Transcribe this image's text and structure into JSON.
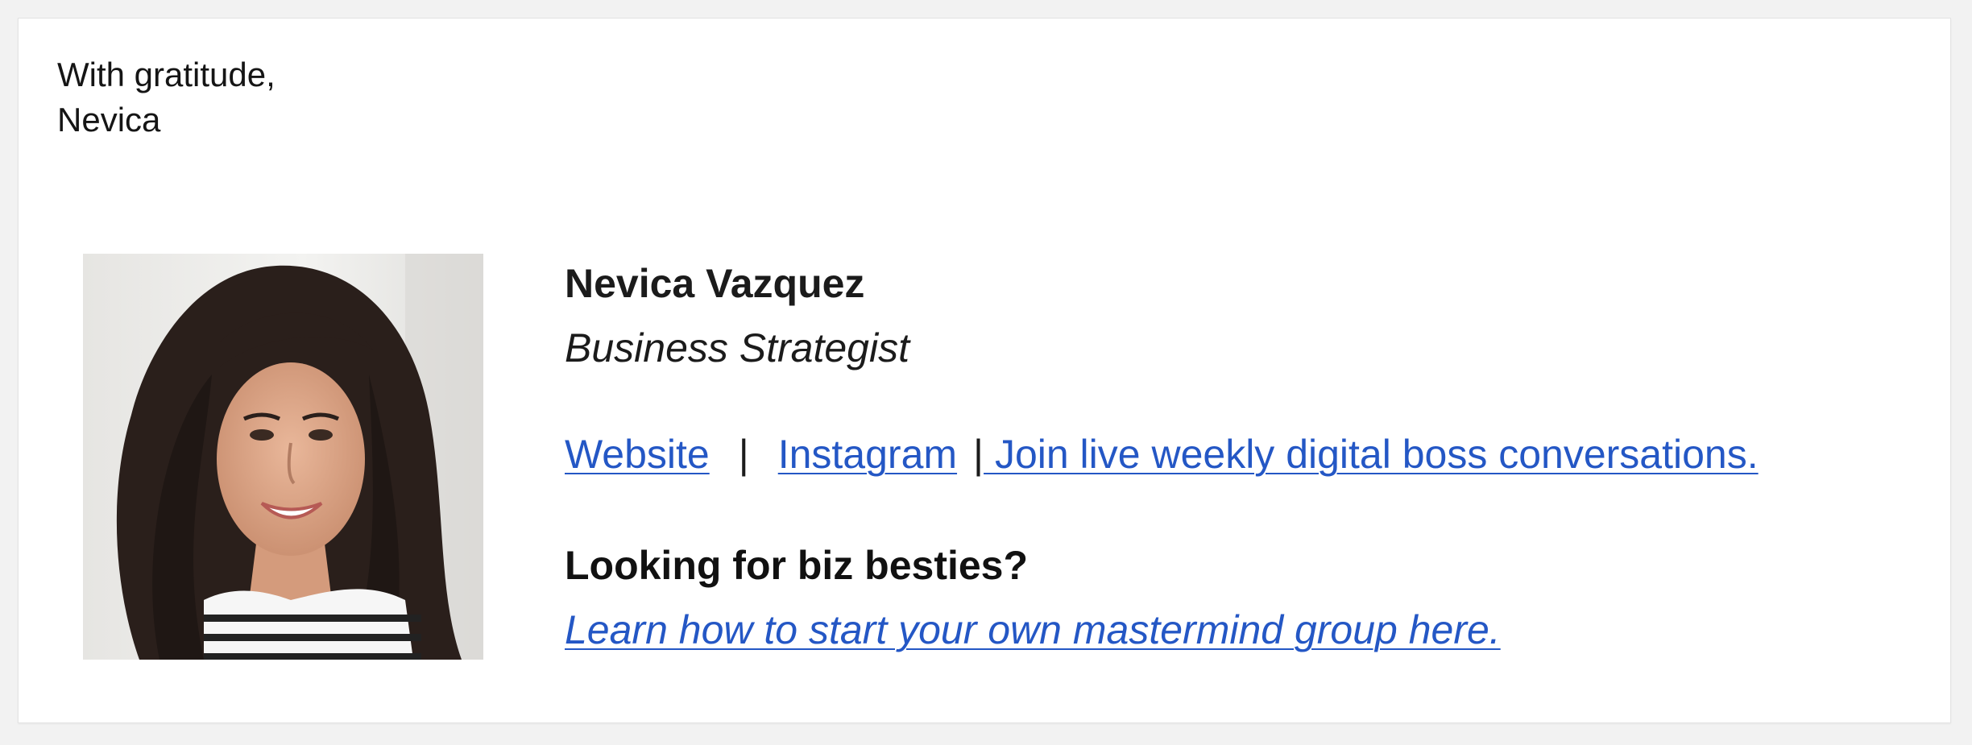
{
  "email": {
    "greeting": {
      "line1": "With gratitude,",
      "line2": "Nevica"
    },
    "signature": {
      "name": "Nevica Vazquez",
      "title": "Business Strategist",
      "links": {
        "website": "Website",
        "separator1": "|",
        "instagram": "Instagram",
        "separator2": "|",
        "conversations": " Join live weekly digital boss conversations."
      },
      "question": "Looking for biz besties?",
      "cta": "Learn how to start your own mastermind group here."
    },
    "colors": {
      "link": "#2457c5",
      "text": "#1b1b1b",
      "background": "#ffffff",
      "outer": "#f2f2f2"
    }
  }
}
